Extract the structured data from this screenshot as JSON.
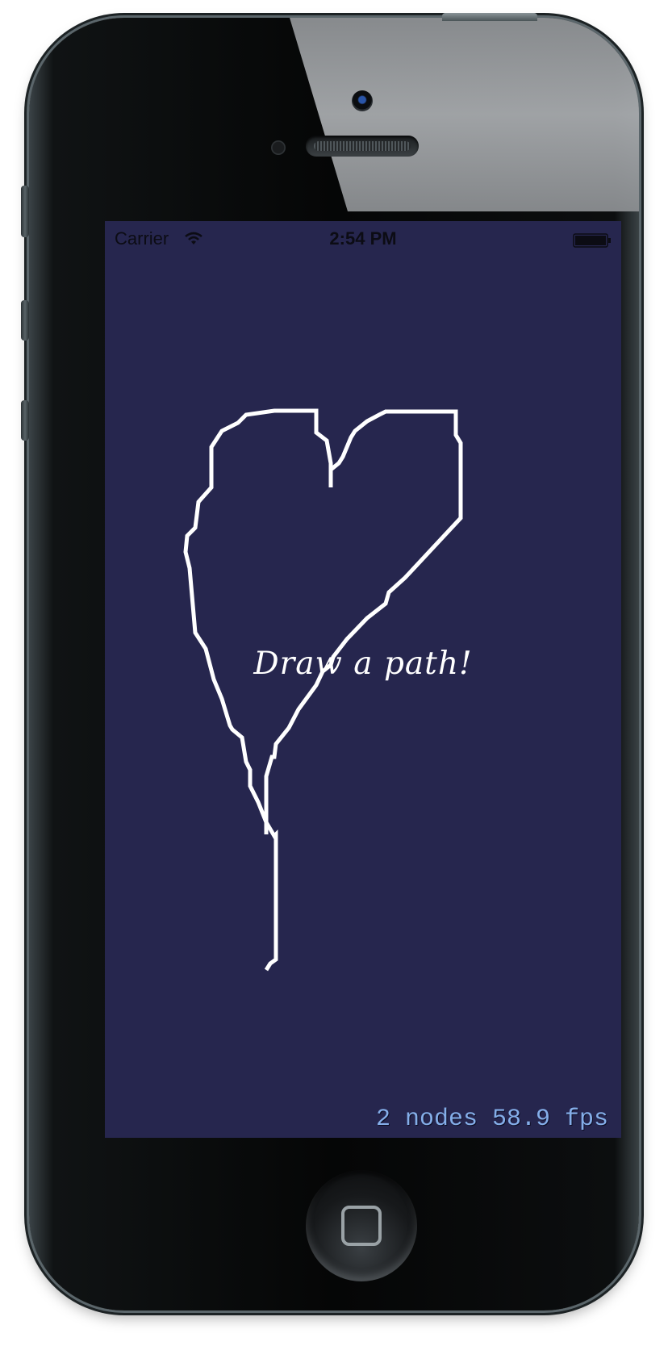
{
  "status_bar": {
    "carrier": "Carrier",
    "time": "2:54 PM",
    "wifi_icon": "wifi-icon",
    "battery_icon": "battery-icon"
  },
  "scene": {
    "prompt": "Draw a path!",
    "stats": "2 nodes 58.9 fps"
  },
  "colors": {
    "screen_background": "#26264e",
    "path_stroke": "#ffffff",
    "stats_text": "#84aee9"
  }
}
